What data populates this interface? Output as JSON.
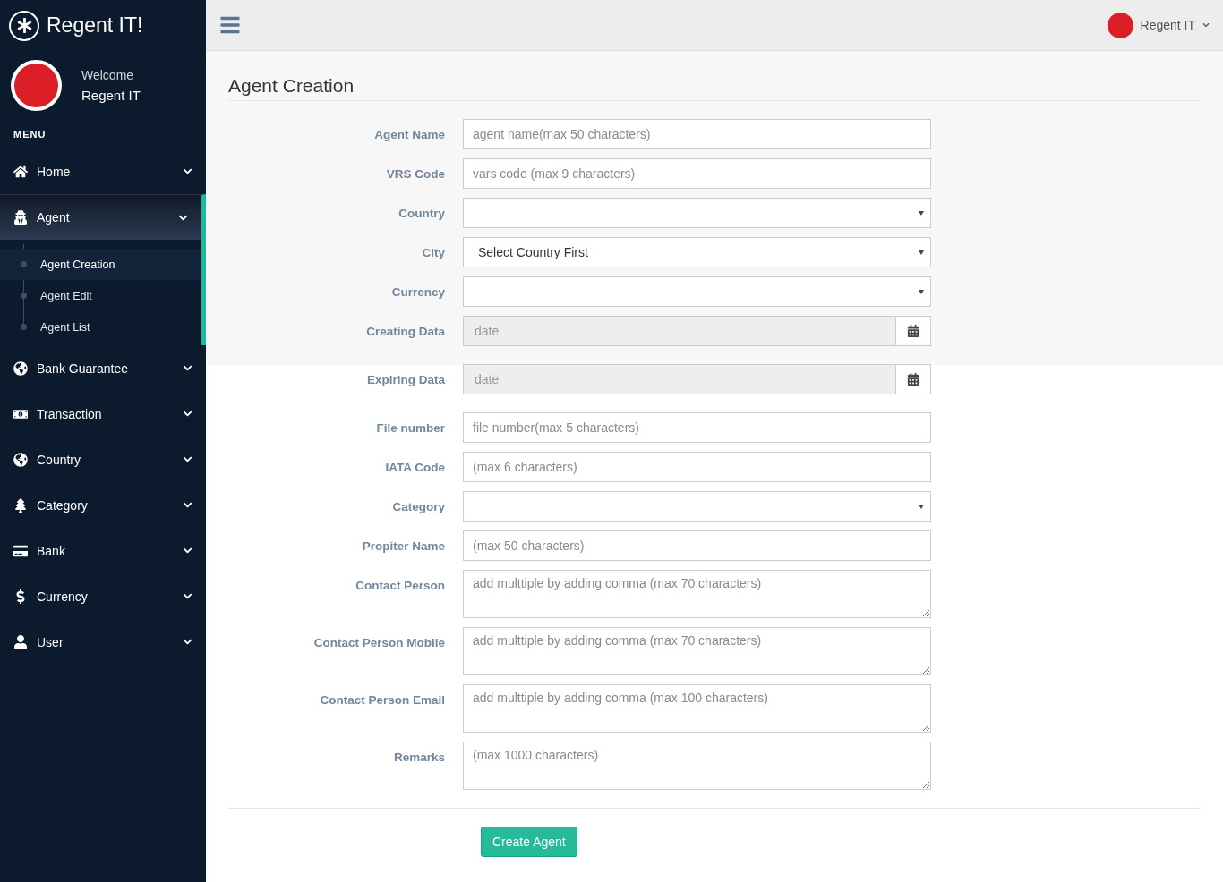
{
  "brand": {
    "title": "Regent IT!"
  },
  "profile": {
    "greeting": "Welcome",
    "name": "Regent IT"
  },
  "menu_title": "MENU",
  "sidebar": {
    "items": [
      {
        "label": "Home",
        "expanded": false
      },
      {
        "label": "Agent",
        "expanded": true,
        "children": [
          {
            "label": "Agent Creation",
            "selected": true
          },
          {
            "label": "Agent Edit",
            "selected": false
          },
          {
            "label": "Agent List",
            "selected": false
          }
        ]
      },
      {
        "label": "Bank Guarantee",
        "expanded": false
      },
      {
        "label": "Transaction",
        "expanded": false
      },
      {
        "label": "Country",
        "expanded": false
      },
      {
        "label": "Category",
        "expanded": false
      },
      {
        "label": "Bank",
        "expanded": false
      },
      {
        "label": "Currency",
        "expanded": false
      },
      {
        "label": "User",
        "expanded": false
      }
    ]
  },
  "header": {
    "user": "Regent IT"
  },
  "page_title": "Agent Creation",
  "form": {
    "fields": [
      {
        "kind": "text",
        "label": "Agent Name",
        "placeholder": "agent name(max 50 characters)"
      },
      {
        "kind": "text",
        "label": "VRS Code",
        "placeholder": "vars code (max 9 characters)"
      },
      {
        "kind": "select",
        "label": "Country"
      },
      {
        "kind": "select",
        "label": "City",
        "value": "Select Country First"
      },
      {
        "kind": "select",
        "label": "Currency"
      },
      {
        "kind": "date",
        "label": "Creating Data",
        "placeholder": "date"
      },
      {
        "kind": "date",
        "label": "Expiring Data",
        "placeholder": "date"
      },
      {
        "kind": "text",
        "label": "File number",
        "placeholder": "file number(max 5 characters)"
      },
      {
        "kind": "text",
        "label": "IATA Code",
        "placeholder": "(max 6 characters)"
      },
      {
        "kind": "select",
        "label": "Category"
      },
      {
        "kind": "text",
        "label": "Propiter Name",
        "placeholder": "(max 50 characters)"
      },
      {
        "kind": "textarea",
        "label": "Contact Person",
        "placeholder": "add multtiple by adding comma (max 70 characters)"
      },
      {
        "kind": "textarea",
        "label": "Contact Person Mobile",
        "placeholder": "add multtiple by adding comma (max 70 characters)"
      },
      {
        "kind": "textarea",
        "label": "Contact Person Email",
        "placeholder": "add multtiple by adding comma (max 100 characters)"
      },
      {
        "kind": "textarea",
        "label": "Remarks",
        "placeholder": "(max 1000 characters)"
      }
    ],
    "submit": "Create Agent"
  }
}
